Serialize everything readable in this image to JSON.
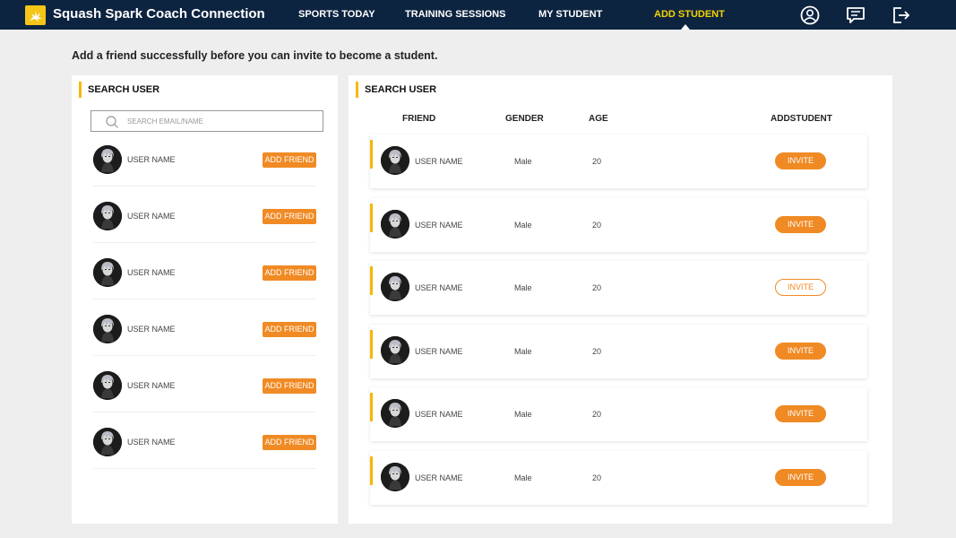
{
  "header": {
    "app_title": "Squash Spark Coach Connection",
    "nav": [
      {
        "label": "SPORTS TODAY"
      },
      {
        "label": "TRAINING SESSIONS"
      },
      {
        "label": "MY STUDENT"
      },
      {
        "label": "ADD STUDENT",
        "active": true
      }
    ],
    "icons": [
      "user-circle-icon",
      "message-icon",
      "logout-icon"
    ]
  },
  "intro_text": "Add a friend successfully before you can invite to become a student.",
  "left_panel": {
    "title": "SEARCH USER",
    "search": {
      "placeholder": "SEARCH EMAIL/NAME",
      "value": ""
    },
    "users": [
      {
        "name": "USER NAME",
        "button": "ADD FRIEND"
      },
      {
        "name": "USER NAME",
        "button": "ADD FRIEND"
      },
      {
        "name": "USER NAME",
        "button": "ADD FRIEND"
      },
      {
        "name": "USER NAME",
        "button": "ADD FRIEND"
      },
      {
        "name": "USER NAME",
        "button": "ADD FRIEND"
      },
      {
        "name": "USER NAME",
        "button": "ADD FRIEND"
      }
    ]
  },
  "right_panel": {
    "title": "SEARCH USER",
    "columns": [
      "FRIEND",
      "GENDER",
      "AGE",
      "ADDSTUDENT"
    ],
    "rows": [
      {
        "name": "USER NAME",
        "gender": "Male",
        "age": "20",
        "button": "INVITE",
        "style": "filled"
      },
      {
        "name": "USER NAME",
        "gender": "Male",
        "age": "20",
        "button": "INVITE",
        "style": "filled"
      },
      {
        "name": "USER NAME",
        "gender": "Male",
        "age": "20",
        "button": "INVITE",
        "style": "outline"
      },
      {
        "name": "USER NAME",
        "gender": "Male",
        "age": "20",
        "button": "INVITE",
        "style": "filled"
      },
      {
        "name": "USER NAME",
        "gender": "Male",
        "age": "20",
        "button": "INVITE",
        "style": "filled"
      },
      {
        "name": "USER NAME",
        "gender": "Male",
        "age": "20",
        "button": "INVITE",
        "style": "filled"
      }
    ]
  },
  "colors": {
    "header_bg": "#0d2440",
    "active_nav": "#f5d300",
    "accent_orange": "#f08a24",
    "accent_yellow": "#f5b800"
  }
}
